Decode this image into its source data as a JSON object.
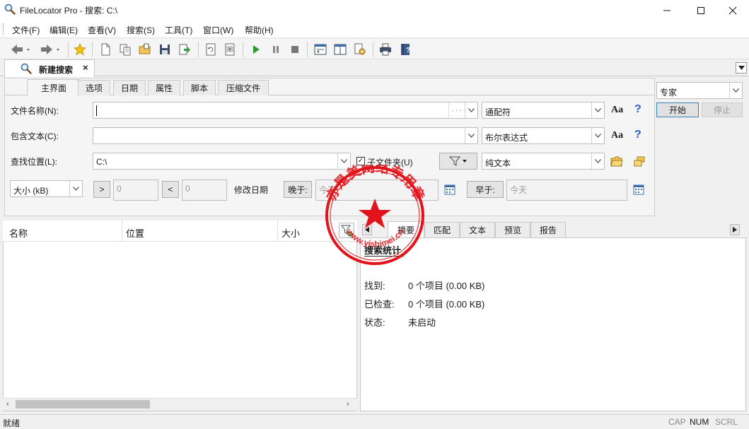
{
  "window": {
    "title": "FileLocator Pro - 搜索: C:\\"
  },
  "menu": [
    "文件(F)",
    "编辑(E)",
    "查看(V)",
    "搜索(S)",
    "工具(T)",
    "窗口(W)",
    "帮助(H)"
  ],
  "doc_tab": {
    "label": "新建搜索",
    "close": "×"
  },
  "criteria_tabs": [
    "主界面",
    "选项",
    "日期",
    "属性",
    "脚本",
    "压缩文件"
  ],
  "form": {
    "filename_label": "文件名称(N):",
    "filename_value": "",
    "filename_browse": "· · ·",
    "filename_mode": "通配符",
    "content_label": "包含文本(C):",
    "content_value": "",
    "content_mode": "布尔表达式",
    "location_label": "查找位置(L):",
    "location_value": "C:\\",
    "subfolders_label": "子文件夹(U)",
    "location_mode": "纯文本",
    "case_icon": "Aa",
    "help_icon": "?",
    "size_unit": "大小 (kB)",
    "gt": ">",
    "lt": "<",
    "size_min": "0",
    "size_max": "0",
    "modified_label": "修改日期",
    "after_label": "晚于:",
    "after_value": "今天",
    "before_label": "早于:",
    "before_value": "今天"
  },
  "side": {
    "mode": "专家",
    "start": "开始",
    "stop": "停止"
  },
  "results": {
    "columns": [
      "名称",
      "位置",
      "大小"
    ]
  },
  "right_tabs": [
    "摘要",
    "匹配",
    "文本",
    "预览",
    "报告"
  ],
  "summary": {
    "header": "搜索统计",
    "found_label": "找到:",
    "found_value": "0 个项目 (0.00 KB)",
    "checked_label": "已检查:",
    "checked_value": "0 个项目 (0.00 KB)",
    "state_label": "状态:",
    "state_value": "未启动"
  },
  "status": {
    "text": "就绪",
    "cap": "CAP",
    "num": "NUM",
    "scrl": "SCRL"
  },
  "stamp": {
    "text": "亦是美网络专用章",
    "url": "www.yishimei.cn"
  }
}
